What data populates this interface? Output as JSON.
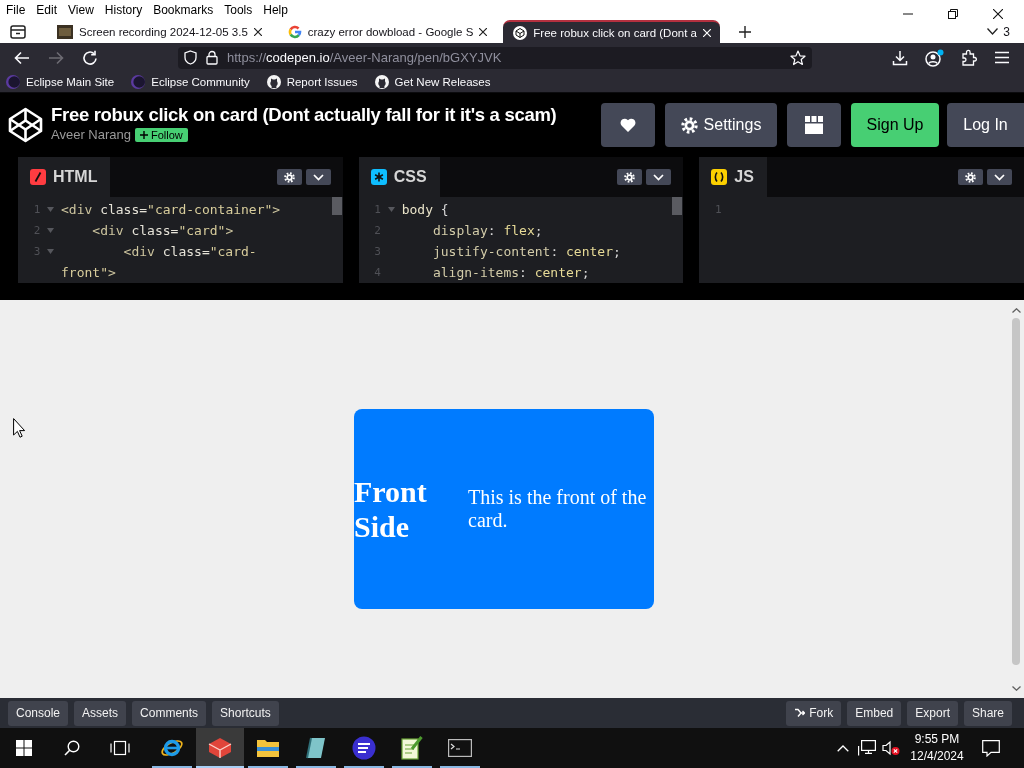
{
  "menu_bar": {
    "items": [
      "File",
      "Edit",
      "View",
      "History",
      "Bookmarks",
      "Tools",
      "Help"
    ]
  },
  "browser_tabs": [
    {
      "kind": "video",
      "title": "Screen recording 2024-12-05 3.5",
      "selected": false
    },
    {
      "kind": "google",
      "title": "crazy error dowbload - Google S",
      "selected": false
    },
    {
      "kind": "codepen",
      "title": "Free robux click on card (Dont a",
      "selected": true
    }
  ],
  "tab_list": {
    "count": "3"
  },
  "nav_bar": {
    "buttons": [
      {
        "kind": "back",
        "disabled": false
      },
      {
        "kind": "forward",
        "disabled": true
      },
      {
        "kind": "reload",
        "disabled": false
      }
    ],
    "url": {
      "scheme": "https://",
      "host": "codepen.io",
      "path": "/Aveer-Narang/pen/bGXYJVK"
    },
    "account_badge": true
  },
  "bookmarks": [
    {
      "kind": "eclipse",
      "label": "Eclipse Main Site"
    },
    {
      "kind": "eclipse",
      "label": "Eclipse Community"
    },
    {
      "kind": "github",
      "label": "Report Issues"
    },
    {
      "kind": "github",
      "label": "Get New Releases"
    }
  ],
  "pen_header": {
    "title": "Free robux click on card (Dont actually fall for it it's a scam)",
    "author": "Aveer Narang",
    "follow": "Follow",
    "buttons": [
      {
        "kind": "like"
      },
      {
        "kind": "settings",
        "label": "Settings"
      },
      {
        "kind": "layout"
      },
      {
        "kind": "signup",
        "label": "Sign Up"
      },
      {
        "kind": "login",
        "label": "Log In"
      }
    ]
  },
  "editors": [
    {
      "kind": "html",
      "label": "HTML",
      "rows": [
        {
          "kind": "line",
          "number": "1",
          "fold": true,
          "tokens": [
            {
              "text": "<div",
              "kind": "tag"
            },
            {
              "text": " class=",
              "kind": "attr"
            },
            {
              "text": "\"card-container\"",
              "kind": "string"
            },
            {
              "text": ">",
              "kind": "tag"
            }
          ]
        },
        {
          "kind": "line",
          "number": "2",
          "fold": true,
          "tokens": [
            {
              "text": "    <div",
              "kind": "tag"
            },
            {
              "text": " class=",
              "kind": "attr"
            },
            {
              "text": "\"card\"",
              "kind": "string"
            },
            {
              "text": ">",
              "kind": "tag"
            }
          ]
        },
        {
          "kind": "line",
          "number": "3",
          "fold": true,
          "tokens": [
            {
              "text": "        <div",
              "kind": "tag"
            },
            {
              "text": " class=",
              "kind": "attr"
            },
            {
              "text": "\"card-",
              "kind": "string"
            }
          ]
        },
        {
          "kind": "wrap",
          "fold": false,
          "tokens": [
            {
              "text": "front\"",
              "kind": "string"
            },
            {
              "text": ">",
              "kind": "tag"
            }
          ]
        }
      ]
    },
    {
      "kind": "css",
      "label": "CSS",
      "rows": [
        {
          "kind": "line",
          "number": "1",
          "fold": true,
          "tokens": [
            {
              "text": "body",
              "kind": "selector"
            },
            {
              "text": " {",
              "kind": "punct"
            }
          ]
        },
        {
          "kind": "line",
          "number": "2",
          "fold": false,
          "tokens": [
            {
              "text": "    display",
              "kind": "property"
            },
            {
              "text": ": ",
              "kind": "punct"
            },
            {
              "text": "flex",
              "kind": "value"
            },
            {
              "text": ";",
              "kind": "punct"
            }
          ]
        },
        {
          "kind": "line",
          "number": "3",
          "fold": false,
          "tokens": [
            {
              "text": "    justify-content",
              "kind": "property"
            },
            {
              "text": ": ",
              "kind": "punct"
            },
            {
              "text": "center",
              "kind": "value"
            },
            {
              "text": ";",
              "kind": "punct"
            }
          ]
        },
        {
          "kind": "line",
          "number": "4",
          "fold": false,
          "tokens": [
            {
              "text": "    align-items",
              "kind": "property"
            },
            {
              "text": ": ",
              "kind": "punct"
            },
            {
              "text": "center",
              "kind": "value"
            },
            {
              "text": ";",
              "kind": "punct"
            }
          ]
        }
      ]
    },
    {
      "kind": "js",
      "label": "JS",
      "rows": [
        {
          "kind": "line",
          "number": "1",
          "fold": false
        }
      ]
    }
  ],
  "preview": {
    "card": {
      "heading": "Front Side",
      "text": "This is the front of the card."
    }
  },
  "footer": {
    "left": [
      {
        "label": "Console"
      },
      {
        "label": "Assets"
      },
      {
        "label": "Comments"
      },
      {
        "label": "Shortcuts"
      }
    ],
    "right": [
      {
        "kind": "fork",
        "label": "Fork"
      },
      {
        "kind": "plain",
        "label": "Embed"
      },
      {
        "kind": "plain",
        "label": "Export"
      },
      {
        "kind": "plain",
        "label": "Share"
      }
    ]
  },
  "taskbar": {
    "apps": [
      {
        "kind": "browser",
        "running": true,
        "selected": false
      },
      {
        "kind": "hexagon",
        "running": true,
        "selected": true
      },
      {
        "kind": "folder",
        "running": true,
        "selected": false
      },
      {
        "kind": "notebook",
        "running": true,
        "selected": false
      },
      {
        "kind": "stripes",
        "running": true,
        "selected": false
      },
      {
        "kind": "notepad",
        "running": true,
        "selected": false
      },
      {
        "kind": "terminal",
        "running": true,
        "selected": false
      }
    ],
    "muted": true,
    "time": "9:55 PM",
    "date": "12/4/2024"
  }
}
